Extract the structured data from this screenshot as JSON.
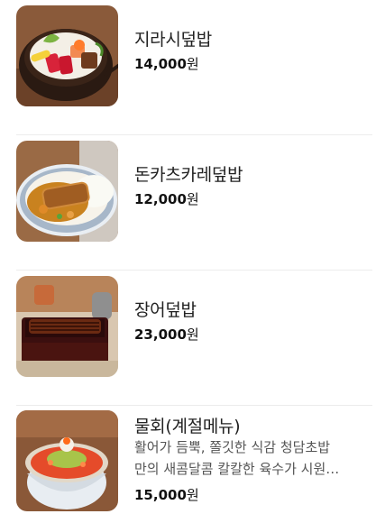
{
  "menu": {
    "items": [
      {
        "name": "지라시덮밥",
        "price": "14,000",
        "currency": "원",
        "image_icon": "chirashi-bowl-image"
      },
      {
        "name": "돈카츠카레덮밥",
        "price": "12,000",
        "currency": "원",
        "image_icon": "katsu-curry-image"
      },
      {
        "name": "장어덮밥",
        "price": "23,000",
        "currency": "원",
        "image_icon": "eel-rice-box-image"
      },
      {
        "name": "물회(계절메뉴)",
        "description_line1": "활어가 듬뿍, 쫄깃한 식감 청담초밥",
        "description_line2": "만의 새콤달콤 칼칼한 육수가 시원…",
        "price": "15,000",
        "currency": "원",
        "image_icon": "mulhoe-bowl-image"
      }
    ]
  }
}
